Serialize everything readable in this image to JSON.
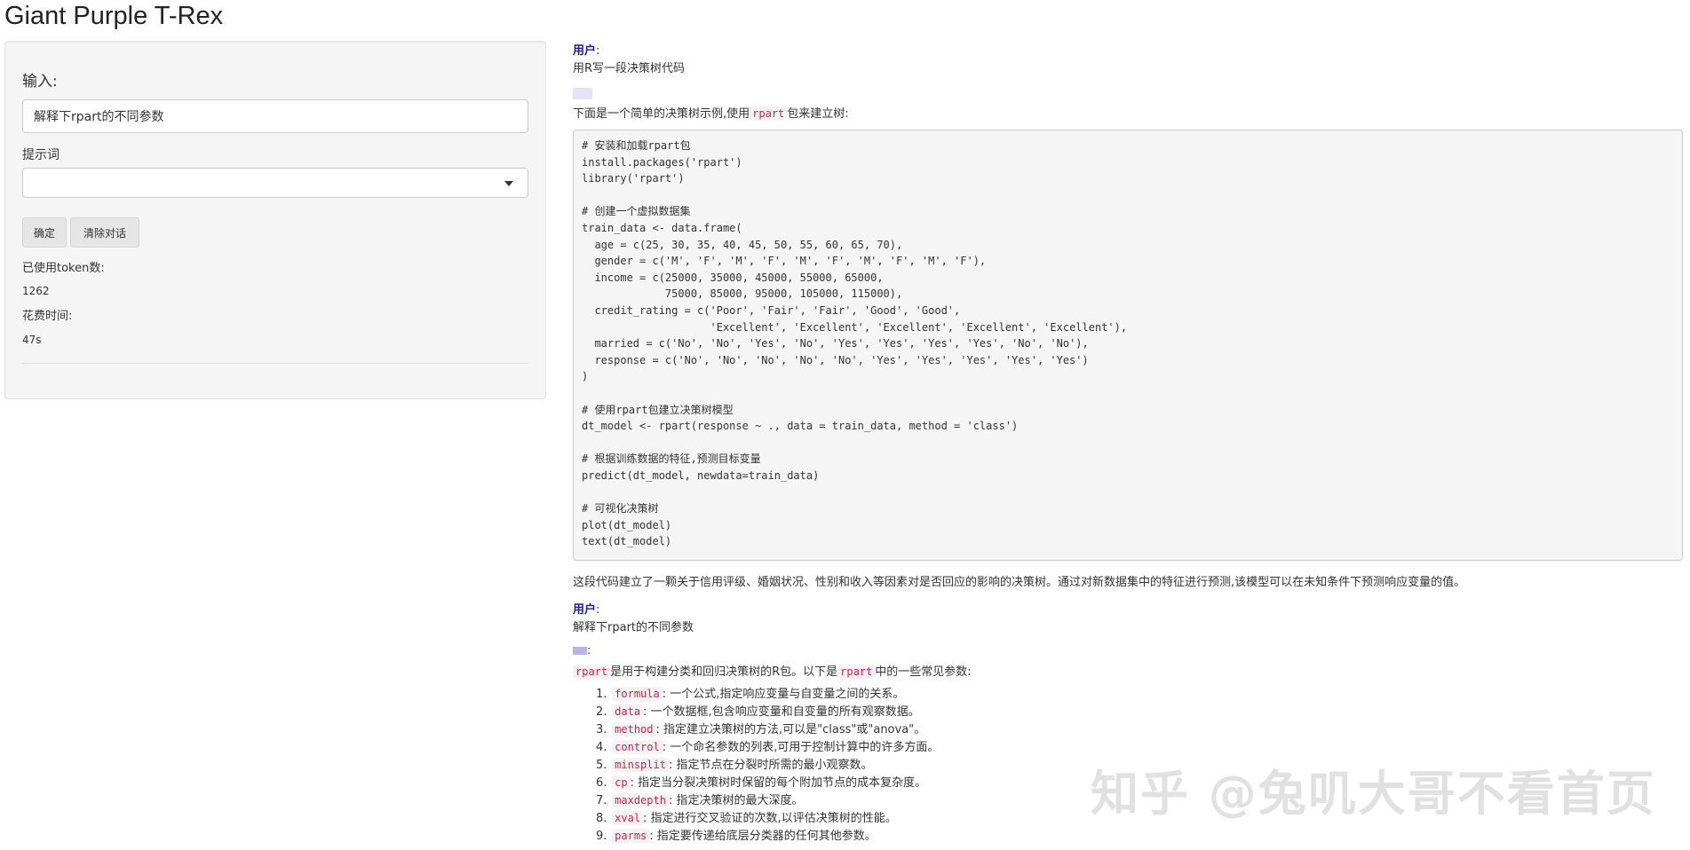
{
  "app": {
    "title": "Giant Purple T-Rex"
  },
  "sidebar": {
    "input_label": "输入:",
    "input_value": "解释下rpart的不同参数",
    "prompt_label": "提示词",
    "prompt_selected": "",
    "confirm_label": "确定",
    "clear_label": "清除对话",
    "tokens_label": "已使用token数:",
    "tokens_value": "1262",
    "time_label": "花费时间:",
    "time_value": "47s"
  },
  "chat": {
    "user_role": "用户",
    "colon": ":",
    "msg1_user": "用R写一段决策树代码",
    "reply1_intro_pre": "下面是一个简单的决策树示例,使用",
    "reply1_intro_code": "rpart",
    "reply1_intro_post": "包来建立树:",
    "code_block": "# 安装和加载rpart包\ninstall.packages('rpart')\nlibrary('rpart')\n\n# 创建一个虚拟数据集\ntrain_data <- data.frame(\n  age = c(25, 30, 35, 40, 45, 50, 55, 60, 65, 70),\n  gender = c('M', 'F', 'M', 'F', 'M', 'F', 'M', 'F', 'M', 'F'),\n  income = c(25000, 35000, 45000, 55000, 65000,\n             75000, 85000, 95000, 105000, 115000),\n  credit_rating = c('Poor', 'Fair', 'Fair', 'Good', 'Good',\n                    'Excellent', 'Excellent', 'Excellent', 'Excellent', 'Excellent'),\n  married = c('No', 'No', 'Yes', 'No', 'Yes', 'Yes', 'Yes', 'Yes', 'No', 'No'),\n  response = c('No', 'No', 'No', 'No', 'No', 'Yes', 'Yes', 'Yes', 'Yes', 'Yes')\n)\n\n# 使用rpart包建立决策树模型\ndt_model <- rpart(response ~ ., data = train_data, method = 'class')\n\n# 根据训练数据的特征,预测目标变量\npredict(dt_model, newdata=train_data)\n\n# 可视化决策树\nplot(dt_model)\ntext(dt_model)",
    "reply1_summary": "这段代码建立了一颗关于信用评级、婚姻状况、性别和收入等因素对是否回应的影响的决策树。通过对新数据集中的特征进行预测,该模型可以在未知条件下预测响应变量的值。",
    "msg2_user": "解释下rpart的不同参数",
    "reply2_intro_code1": "rpart",
    "reply2_intro_mid": "是用于构建分类和回归决策树的R包。以下是",
    "reply2_intro_code2": "rpart",
    "reply2_intro_post": "中的一些常见参数:",
    "params": [
      {
        "num": "1.",
        "code": "formula",
        "desc": ": 一个公式,指定响应变量与自变量之间的关系。"
      },
      {
        "num": "2.",
        "code": "data",
        "desc": ": 一个数据框,包含响应变量和自变量的所有观察数据。"
      },
      {
        "num": "3.",
        "code": "method",
        "desc": ": 指定建立决策树的方法,可以是\"class\"或\"anova\"。"
      },
      {
        "num": "4.",
        "code": "control",
        "desc": ": 一个命名参数的列表,可用于控制计算中的许多方面。"
      },
      {
        "num": "5.",
        "code": "minsplit",
        "desc": ": 指定节点在分裂时所需的最小观察数。"
      },
      {
        "num": "6.",
        "code": "cp",
        "desc": ": 指定当分裂决策树时保留的每个附加节点的成本复杂度。"
      },
      {
        "num": "7.",
        "code": "maxdepth",
        "desc": ": 指定决策树的最大深度。"
      },
      {
        "num": "8.",
        "code": "xval",
        "desc": ": 指定进行交叉验证的次数,以评估决策树的性能。"
      },
      {
        "num": "9.",
        "code": "parms",
        "desc": ": 指定要传递给底层分类器的任何其他参数。"
      }
    ]
  },
  "watermark": "知乎 @兔叽大哥不看首页"
}
